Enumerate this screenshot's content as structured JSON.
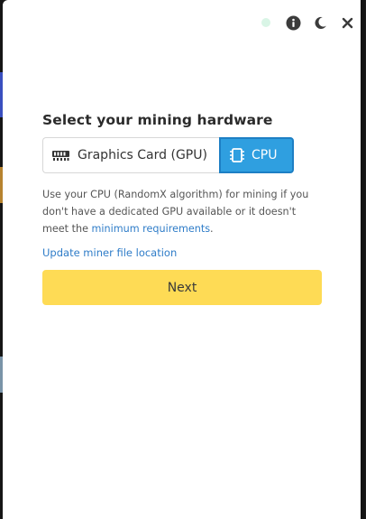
{
  "dialog": {
    "title": "Select your mining hardware",
    "options": [
      {
        "label": "Graphics Card (GPU)",
        "icon": "gpu-card-icon",
        "selected": false
      },
      {
        "label": "CPU",
        "icon": "cpu-chip-icon",
        "selected": true
      }
    ],
    "description_prefix": "Use your CPU (RandomX algorithm) for mining if you don't have a dedicated GPU available or it doesn't meet the ",
    "description_link": "minimum requirements",
    "description_suffix": ".",
    "update_link": "Update miner file location",
    "next_label": "Next"
  },
  "topbar": {
    "status_color": "#d9f5e6",
    "icons": [
      "info-icon",
      "moon-icon",
      "close-icon"
    ]
  },
  "colors": {
    "accent": "#2f9fe0",
    "link": "#2e7cc8",
    "next_button": "#fedb55"
  }
}
